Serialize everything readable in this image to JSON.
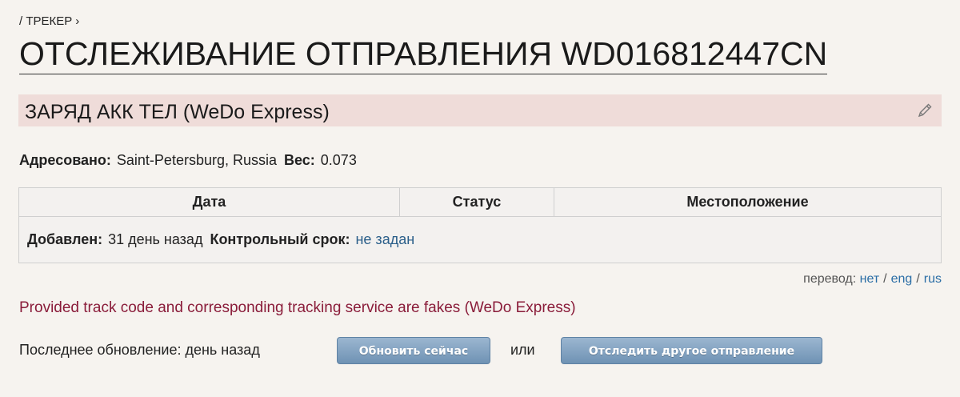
{
  "breadcrumb": {
    "prefix": "/ ",
    "label": "ТРЕКЕР",
    "chevron": "›"
  },
  "title": "ОТСЛЕЖИВАНИЕ ОТПРАВЛЕНИЯ WD016812447CN",
  "item": {
    "name": "ЗАРЯД АКК ТЕЛ (WeDo Express)",
    "edit_icon": "pencil-icon"
  },
  "meta": {
    "addressed_label": "Адресовано:",
    "addressed_value": "Saint-Petersburg, Russia",
    "weight_label": "Вес:",
    "weight_value": "0.073"
  },
  "table": {
    "headers": [
      "Дата",
      "Статус",
      "Местоположение"
    ],
    "added_label": "Добавлен:",
    "added_value": "31 день назад",
    "deadline_label": "Контрольный срок:",
    "deadline_value": "не задан"
  },
  "translate": {
    "label": "перевод:",
    "options": [
      "нет",
      "eng",
      "rus"
    ],
    "separator": "/"
  },
  "notice": "Provided track code and corresponding tracking service are fakes (WeDo Express)",
  "footer": {
    "last_update": "Последнее обновление: день назад",
    "refresh_button": "Обновить сейчас",
    "or": "или",
    "track_other_button": "Отследить другое отправление"
  },
  "colors": {
    "background": "#f6f3ef",
    "item_bar": "#efdcd9",
    "notice": "#8a1c3a",
    "link": "#2b6ea6",
    "button": "#7f9fc0"
  }
}
